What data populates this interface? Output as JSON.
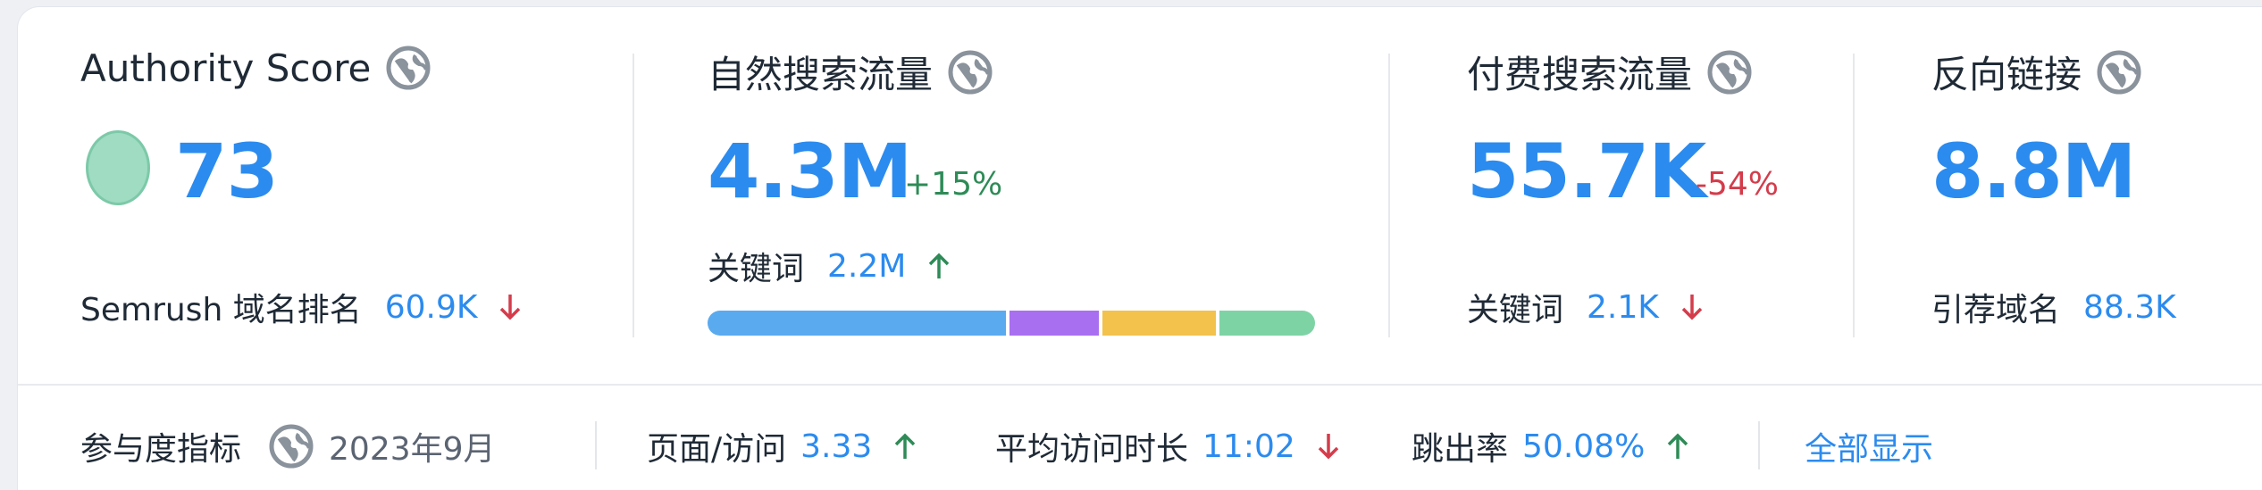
{
  "metrics": {
    "authority": {
      "title": "Authority Score",
      "value": "73",
      "sub_label": "Semrush 域名排名",
      "sub_value": "60.9K",
      "sub_trend": "down"
    },
    "organic": {
      "title": "自然搜索流量",
      "value": "4.3M",
      "delta": "+15%",
      "sub_label": "关键词",
      "sub_value": "2.2M",
      "sub_trend": "up"
    },
    "paid": {
      "title": "付费搜索流量",
      "value": "55.7K",
      "delta": "-54%",
      "sub_label": "关键词",
      "sub_value": "2.1K",
      "sub_trend": "down"
    },
    "backlinks": {
      "title": "反向链接",
      "value": "8.8M",
      "sub_label": "引荐域名",
      "sub_value": "88.3K"
    }
  },
  "keyword_distribution": {
    "fractions": [
      0.5,
      0.15,
      0.19,
      0.16
    ],
    "colors": [
      "#5aaaf0",
      "#a86ff0",
      "#f2c24c",
      "#7ed3a5"
    ]
  },
  "engagement": {
    "label": "参与度指标",
    "date": "2023年9月",
    "pages_per_visit_label": "页面/访问",
    "pages_per_visit": "3.33",
    "pages_trend": "up",
    "avg_duration_label": "平均访问时长",
    "avg_duration": "11:02",
    "duration_trend": "down",
    "bounce_label": "跳出率",
    "bounce": "50.08%",
    "bounce_trend": "up",
    "show_all": "全部显示"
  },
  "colors": {
    "accent": "#2b8bef",
    "up": "#2e8b57",
    "down": "#d43c4b"
  }
}
